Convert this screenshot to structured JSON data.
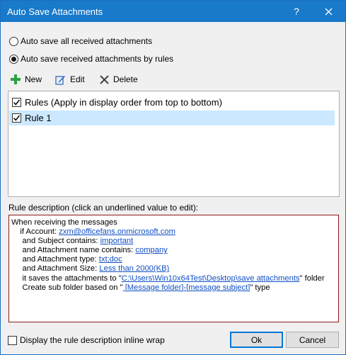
{
  "window": {
    "title": "Auto Save Attachments",
    "help_glyph": "?",
    "close_glyph": "✕"
  },
  "options": {
    "save_all": "Auto save all received attachments",
    "save_by_rules": "Auto save received attachments by rules",
    "selected": "save_by_rules"
  },
  "toolbar": {
    "new_label": "New",
    "edit_label": "Edit",
    "delete_label": "Delete"
  },
  "rules": {
    "header": "Rules (Apply in display order from top to bottom)",
    "items": [
      {
        "label": "Rule 1",
        "checked": true
      }
    ]
  },
  "description": {
    "label": "Rule description (click an underlined value to edit):",
    "lines": [
      {
        "text": "When receiving the messages"
      },
      {
        "text": "    if Account: ",
        "link": "zxm@officefans.onmicrosoft.com",
        "suffix": ""
      },
      {
        "text": "     and Subject contains: ",
        "link": "important",
        "suffix": ""
      },
      {
        "text": "     and Attachment name contains: ",
        "link": "company",
        "suffix": ""
      },
      {
        "text": "     and Attachment type: ",
        "link": "txt;doc",
        "suffix": ""
      },
      {
        "text": "     and Attachment Size: ",
        "link": "Less than 2000(KB)",
        "suffix": ""
      },
      {
        "text": "     it saves the attachments to \"",
        "link": "C:\\Users\\Win10x64Test\\Desktop\\save attachments",
        "suffix": "\" folder"
      },
      {
        "text": "     Create sub folder based on \"",
        "link": " [Message folder]-[message subject]",
        "suffix": "\" type"
      }
    ]
  },
  "footer": {
    "wrap_label": "Display the rule description inline wrap",
    "ok_label": "Ok",
    "cancel_label": "Cancel"
  },
  "colors": {
    "titlebar": "#1979ca",
    "selection": "#cce8ff",
    "link": "#0f4fc6",
    "desc_border": "#8b1a1a",
    "new_icon": "#2ea043",
    "edit_icon": "#1f5fbf"
  }
}
